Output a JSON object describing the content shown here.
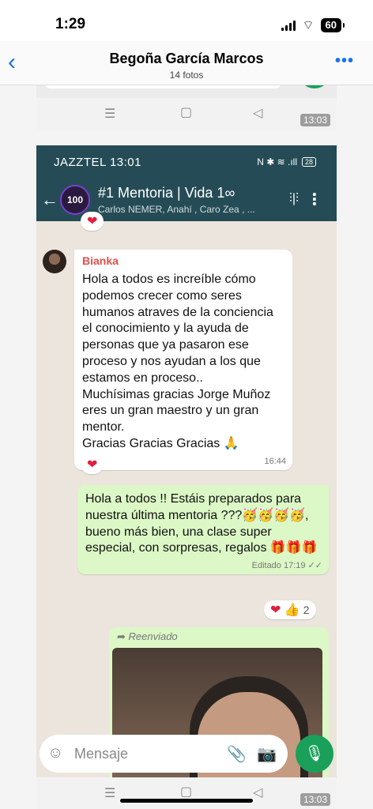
{
  "ios_status": {
    "time": "1:29",
    "battery": "60"
  },
  "ios_nav": {
    "back": "‹",
    "title": "Begoña García Marcos",
    "subtitle": "14 fotos",
    "more": "•••"
  },
  "screenshot_top": {
    "time": "13:03"
  },
  "android_status": {
    "carrier_time": "JAZZTEL  13:01",
    "battery": "28",
    "icons": "N ✱ ≋ .ıll"
  },
  "chat_header": {
    "avatar_text": "100",
    "title": "#1 Mentoria | Vida 1∞",
    "members": "Carlos NEMER, Anahí , Caro Zea , ..."
  },
  "messages": [
    {
      "sender": "Bianka",
      "text": "Hola a todos es increíble cómo podemos crecer como seres humanos atraves de la conciencia el conocimiento y la ayuda de personas que ya pasaron ese proceso y nos ayudan a los que estamos en proceso..\nMuchísimas gracias Jorge Muñoz eres un gran maestro y un gran mentor.\nGracias Gracias Gracias 🙏",
      "time": "16:44",
      "reaction": "❤"
    },
    {
      "text": "Hola a todos !! Estáis preparados para nuestra última mentoria ???🥳🥳🥳🥳, bueno más bien, una clase super especial, con sorpresas, regalos 🎁🎁🎁",
      "time": "Editado 17:19 ✓✓",
      "reaction": "❤ 👍",
      "reaction_count": "2"
    },
    {
      "forwarded_label": "➦ Reenviado"
    }
  ],
  "prev_reaction": "❤",
  "input": {
    "placeholder": "Mensaje"
  },
  "screenshot_bottom": {
    "time": "13:03"
  }
}
